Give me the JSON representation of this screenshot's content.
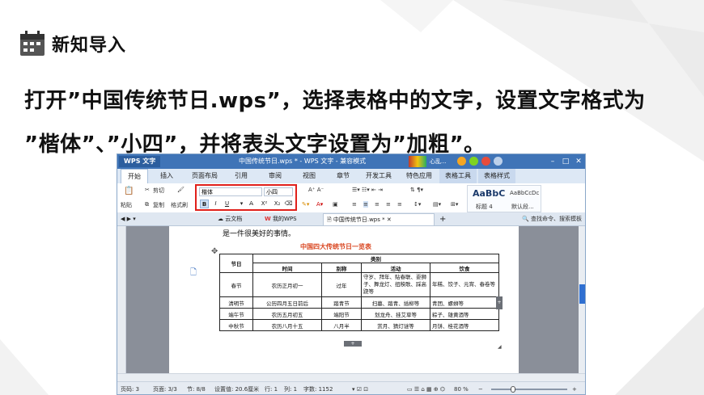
{
  "slide": {
    "section_title": "新知导入",
    "instruction_line1": "打开”中国传统节日.wps”，选择表格中的文字，设置文字格式为",
    "instruction_line2": "”楷体”、”小四”，并将表头文字设置为”加粗”。",
    "accent_color": "#d9d9d9"
  },
  "wps": {
    "app_button": "WPS 文字",
    "window_title": "中国传统节日.wps * - WPS 文字 - 兼容模式",
    "promo_text": "心乱...",
    "menu": [
      "开始",
      "插入",
      "页面布局",
      "引用",
      "审阅",
      "视图",
      "章节",
      "开发工具",
      "特色应用",
      "表格工具",
      "表格样式"
    ],
    "ribbon": {
      "paste": "粘贴",
      "cut": "剪切",
      "copy": "复制",
      "format_painter": "格式刷",
      "font_name": "楷体",
      "font_size": "小四",
      "bold": "B",
      "italic": "I",
      "underline": "U",
      "superscript": "X²",
      "subscript": "X₂",
      "style_preview_1": "AaBbC",
      "style_preview_2": "AaBbCcDc",
      "style_label_1": "标题 4",
      "style_label_2": "默认段..."
    },
    "tabs": [
      "云文档",
      "我的WPS",
      "中国传统节日.wps *"
    ],
    "search_placeholder": "查找命令、搜索模板",
    "document": {
      "intro_text": "是一件很美好的事情。",
      "table_title": "中国四大传统节日一览表",
      "table": {
        "col_festival": "节日",
        "col_category": "类别",
        "col_time": "时间",
        "col_alias": "别称",
        "col_activity": "活动",
        "col_food": "饮食",
        "rows": [
          {
            "festival": "春节",
            "time": "农历正月初一",
            "alias": "过年",
            "activity": "守岁、拜年、贴春联、耍狮子、舞龙灯、扭秧歌、踩高跷等",
            "food": "年糕、饺子、元宵、春卷等"
          },
          {
            "festival": "清明节",
            "time": "公历四月五日前后",
            "alias": "踏青节",
            "activity": "扫墓、踏青、插柳等",
            "food": "青团、螺蛳等"
          },
          {
            "festival": "端午节",
            "time": "农历五月初五",
            "alias": "端阳节",
            "activity": "划龙舟、挂艾草等",
            "food": "粽子、雄黄酒等"
          },
          {
            "festival": "中秋节",
            "time": "农历八月十五",
            "alias": "八月半",
            "activity": "赏月、猜灯谜等",
            "food": "月饼、桂花酒等"
          }
        ]
      }
    },
    "status": {
      "page_num": "页码: 3",
      "page": "页面: 3/3",
      "section": "节: 8/8",
      "position": "设置值: 20.6厘米",
      "row": "行: 1",
      "col": "列: 1",
      "words": "字数: 1152",
      "zoom": "80 %"
    }
  }
}
